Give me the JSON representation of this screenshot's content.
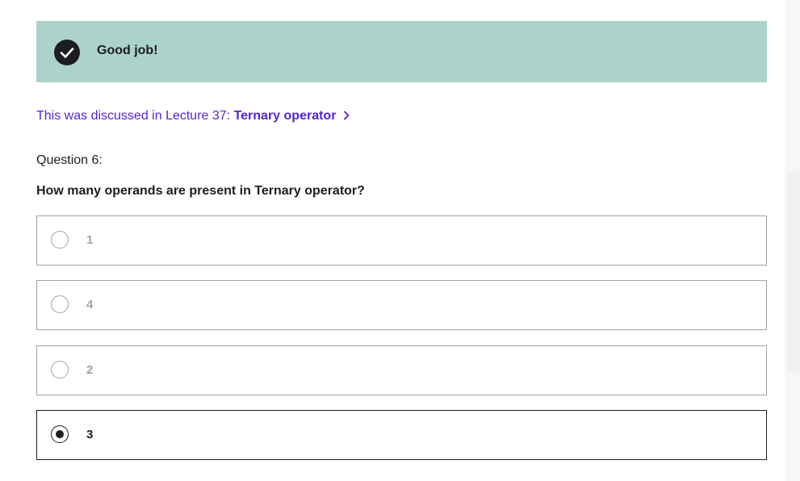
{
  "feedback": {
    "icon": "check-circle-icon",
    "message": "Good job!",
    "background_color": "#acd2cc"
  },
  "lecture_reference": {
    "prefix": "This was discussed in Lecture 37: ",
    "title": "Ternary operator",
    "icon": "chevron-right-icon",
    "color": "#5624d0"
  },
  "question": {
    "number_label": "Question 6:",
    "text": "How many operands are present in Ternary operator?"
  },
  "options": [
    {
      "label": "1",
      "selected": false
    },
    {
      "label": "4",
      "selected": false
    },
    {
      "label": "2",
      "selected": false
    },
    {
      "label": "3",
      "selected": true
    }
  ]
}
